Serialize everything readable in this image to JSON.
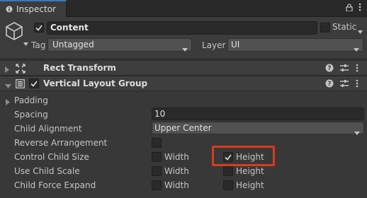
{
  "tab": {
    "title": "Inspector"
  },
  "header": {
    "object_name": "Content",
    "static_label": "Static",
    "tag_label": "Tag",
    "tag_value": "Untagged",
    "layer_label": "Layer",
    "layer_value": "UI"
  },
  "components": [
    {
      "title": "Rect Transform",
      "expanded": false
    },
    {
      "title": "Vertical Layout Group",
      "expanded": true,
      "enabled": true
    }
  ],
  "properties": {
    "padding": "Padding",
    "spacing": {
      "label": "Spacing",
      "value": "10"
    },
    "child_alignment": {
      "label": "Child Alignment",
      "value": "Upper Center"
    },
    "reverse_arrangement": {
      "label": "Reverse Arrangement",
      "checked": false
    },
    "control_child_size": {
      "label": "Control Child Size",
      "width_label": "Width",
      "height_label": "Height",
      "width": false,
      "height": true
    },
    "use_child_scale": {
      "label": "Use Child Scale",
      "width_label": "Width",
      "height_label": "Height",
      "width": false,
      "height": false
    },
    "child_force_expand": {
      "label": "Child Force Expand",
      "width_label": "Width",
      "height_label": "Height",
      "width": false,
      "height": false
    }
  },
  "colors": {
    "highlight": "#d93b1f",
    "accent": "#3a79bb",
    "background": "#383838"
  }
}
